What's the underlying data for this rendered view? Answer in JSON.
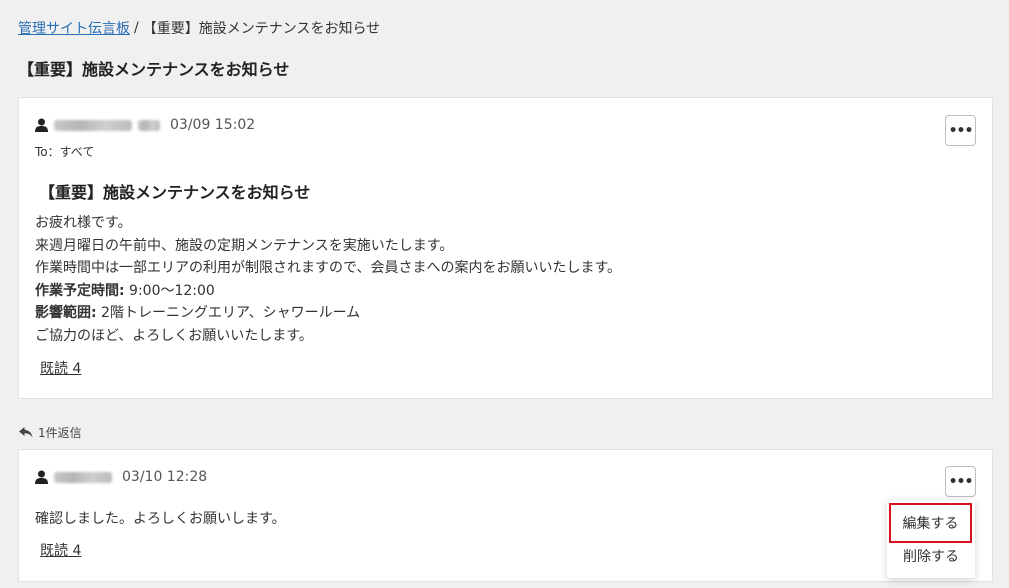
{
  "breadcrumb": {
    "parent": "管理サイト伝言板",
    "separator": "/",
    "current": "【重要】施設メンテナンスをお知らせ"
  },
  "page_title": "【重要】施設メンテナンスをお知らせ",
  "post": {
    "timestamp": "03/09 15:02",
    "to": "To：すべて",
    "title": "【重要】施設メンテナンスをお知らせ",
    "lines": [
      "お疲れ様です。",
      "来週月曜日の午前中、施設の定期メンテナンスを実施いたします。",
      "作業時間中は一部エリアの利用が制限されますので、会員さまへの案内をお願いいたします。"
    ],
    "schedule_label": "作業予定時間:",
    "schedule_value": " 9:00〜12:00",
    "area_label": "影響範囲:",
    "area_value": " 2階トレーニングエリア、シャワールーム",
    "closing": "ご協力のほど、よろしくお願いいたします。",
    "read_label": "既読 4"
  },
  "reply_count": "1件返信",
  "reply": {
    "timestamp": "03/10 12:28",
    "text": "確認しました。よろしくお願いします。",
    "read_label": "既読 4"
  },
  "menu": {
    "edit": "編集する",
    "delete": "削除する"
  },
  "more_label": "•••",
  "colors": {
    "link": "#2a6fb5",
    "highlight": "#d9111e",
    "background": "#f0f0f0"
  }
}
